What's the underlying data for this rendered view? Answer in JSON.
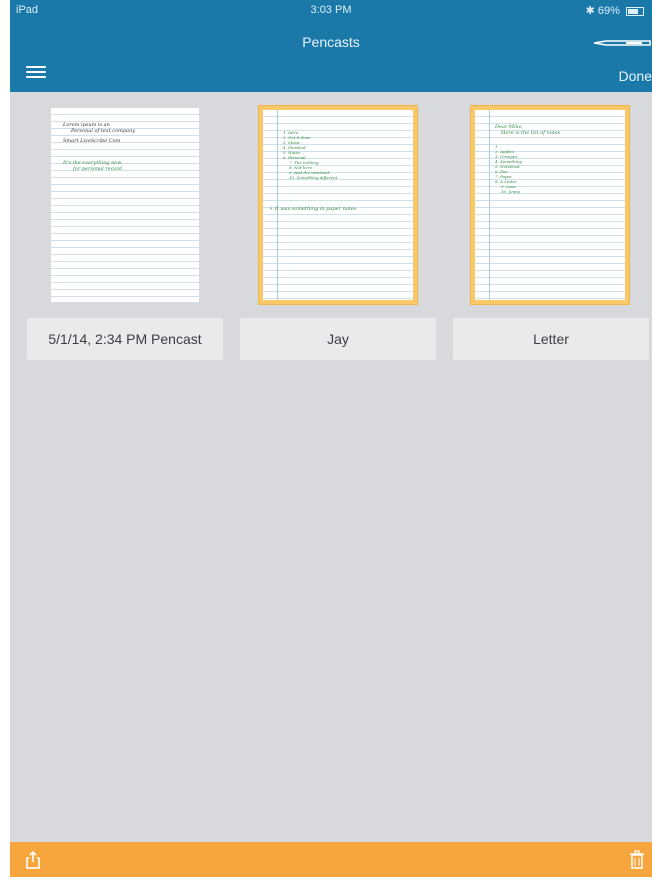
{
  "status": {
    "device": "iPad",
    "time": "3:03 PM",
    "battery": "69%"
  },
  "nav": {
    "title": "Pencasts",
    "done_label": "Done"
  },
  "pencasts": [
    {
      "label": "5/1/14, 2:34 PM Pencast",
      "selected": false,
      "lines_black": [
        "Lorem ipsum is an",
        "Personal of text company",
        "Smart LiveScribe Com"
      ],
      "lines_green": [
        "It's the everything now",
        "for personal record"
      ]
    },
    {
      "label": "Jay",
      "selected": true,
      "lines_green": [
        "1. Intro",
        "2. Get it done",
        "3. Music",
        "4. Finished",
        "5. Notes",
        "6. Personal",
        "7. The nothing",
        "8. Not here",
        "9. And the notebook",
        "10. Something different"
      ],
      "footer": "+ It was something in paper notes"
    },
    {
      "label": "Letter",
      "selected": true,
      "lines_black": [
        "Dear Mike,",
        "Here is the list of notes"
      ],
      "lines_green": [
        "1.",
        "2. Apples",
        "3. Oranges",
        "4. Something",
        "5. Notebook",
        "6. Pen",
        "7. Paper",
        "8. A Letter",
        "9. Love",
        "10. Jenny"
      ]
    }
  ],
  "colors": {
    "nav_bg": "#1b79aa",
    "accent": "#f7a63d",
    "selection": "#f8c869",
    "background": "#d8d9dc"
  },
  "icons": {
    "menu": "hamburger-icon",
    "pen": "pen-icon",
    "share": "share-icon",
    "trash": "trash-icon"
  }
}
